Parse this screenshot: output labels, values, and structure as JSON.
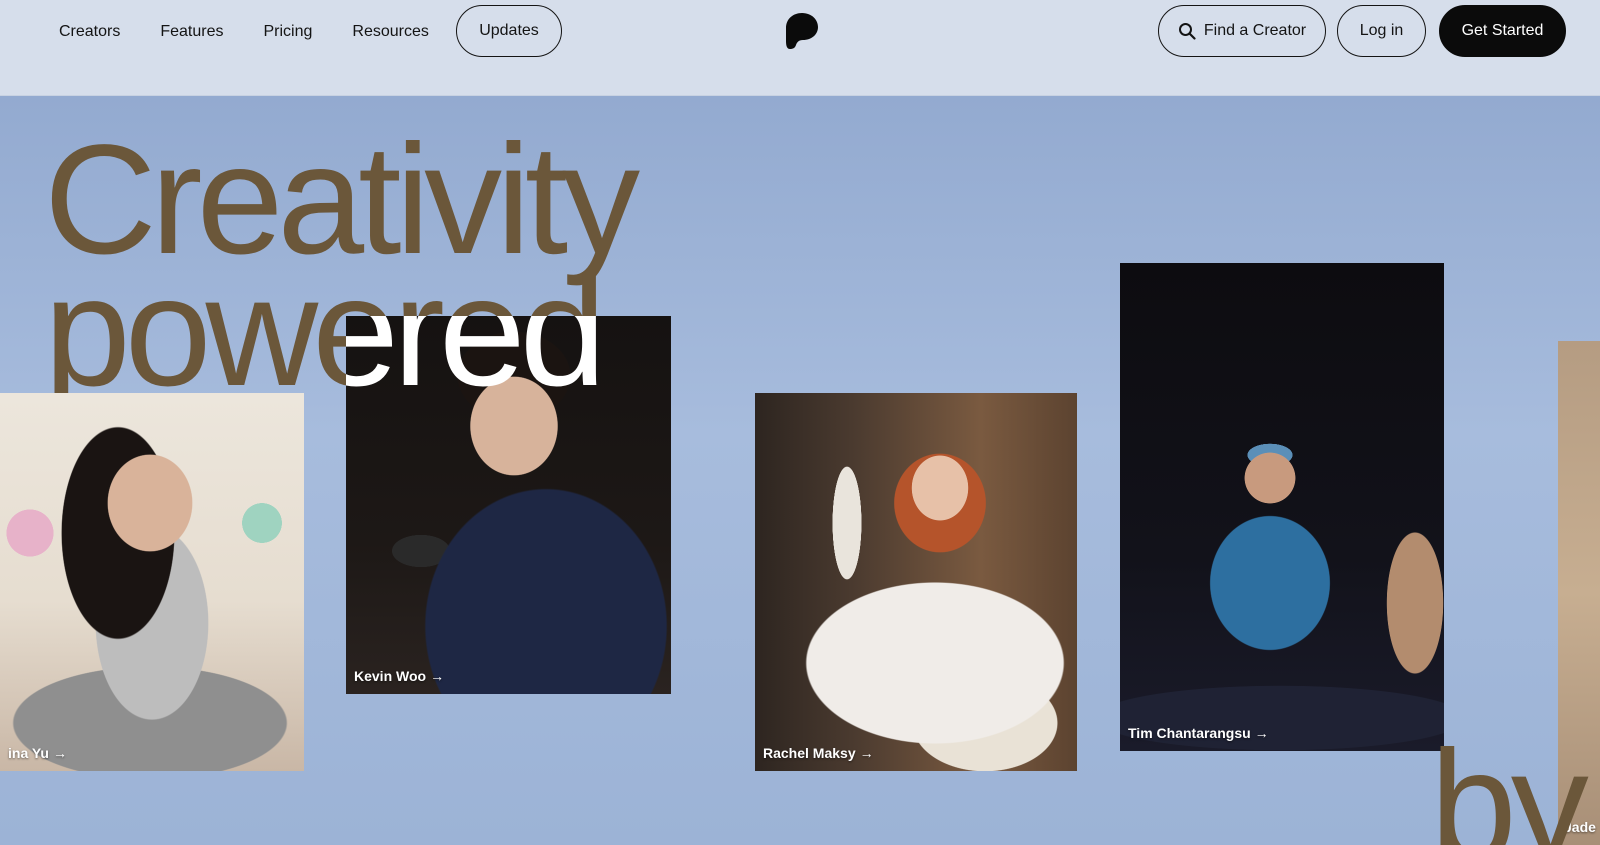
{
  "nav": {
    "links": [
      "Creators",
      "Features",
      "Pricing",
      "Resources"
    ],
    "updates": "Updates",
    "find_creator": "Find a Creator",
    "log_in": "Log in",
    "get_started": "Get Started"
  },
  "hero": {
    "line1": "Creativity",
    "line2": "powered",
    "line3": "by",
    "cards": [
      {
        "name": "ina Yu",
        "arrow": "→"
      },
      {
        "name": "Kevin Woo",
        "arrow": "→"
      },
      {
        "name": "Rachel Maksy",
        "arrow": "→"
      },
      {
        "name": "Tim Chantarangsu",
        "arrow": "→"
      },
      {
        "name": "Jade"
      }
    ]
  },
  "colors": {
    "headline": "#6b573a",
    "topbar": "#d6deeb",
    "hero_bg": "#a1b6d8",
    "cta": "#0b0b0b"
  }
}
